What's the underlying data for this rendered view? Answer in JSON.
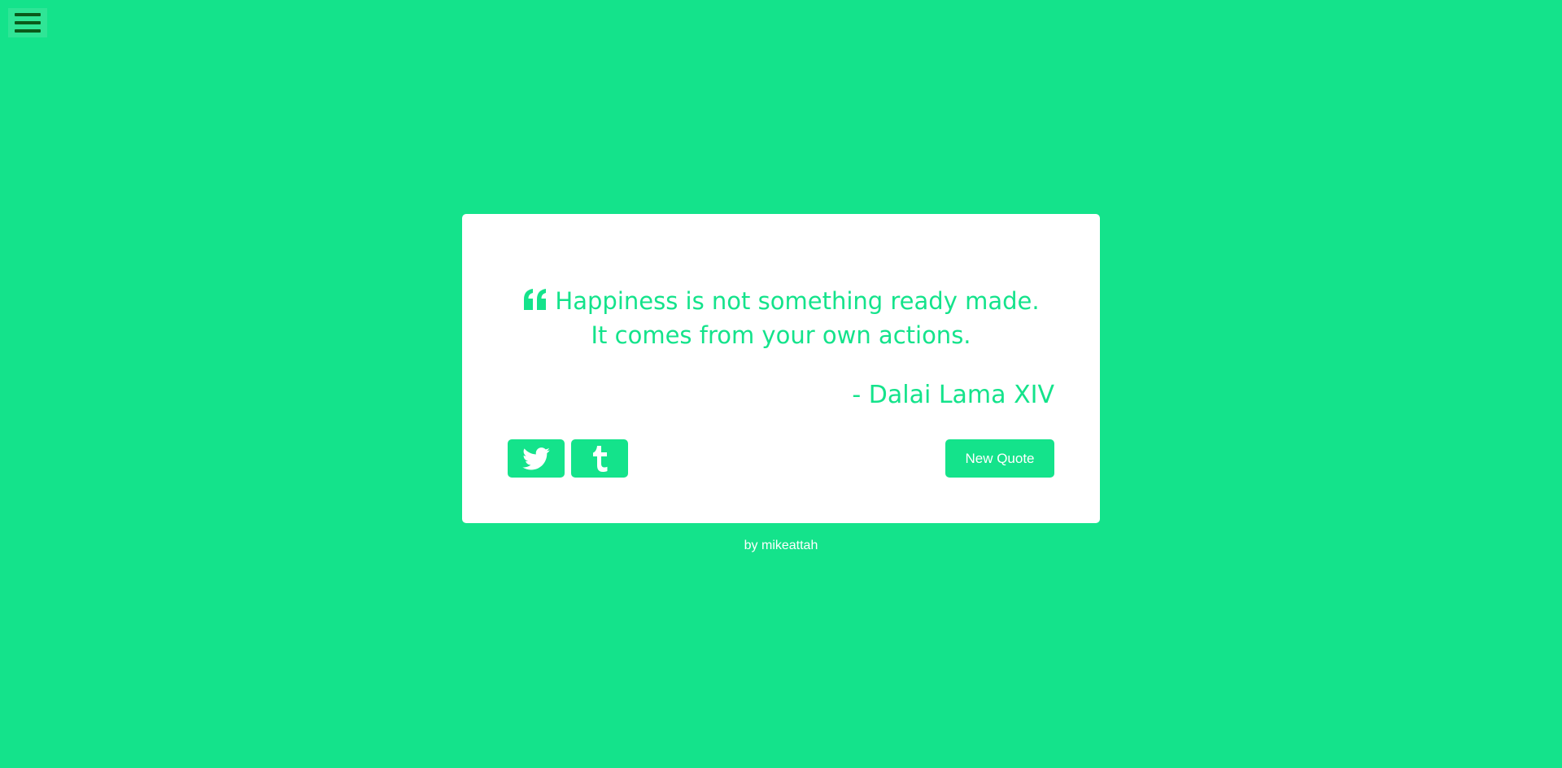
{
  "colors": {
    "background": "#14e38b",
    "card": "#ffffff",
    "accent": "#14e38b",
    "menu_bars": "#0a5a1a"
  },
  "menu": {
    "icon": "hamburger-menu-icon"
  },
  "quote": {
    "icon": "quote-left-icon",
    "text": "Happiness is not something ready made. It comes from your own actions.",
    "author": "- Dalai Lama XIV"
  },
  "share": {
    "twitter_icon": "twitter-icon",
    "tumblr_icon": "tumblr-icon"
  },
  "actions": {
    "new_quote_label": "New Quote"
  },
  "footer": {
    "prefix": "by ",
    "author_link": "mikeattah"
  }
}
